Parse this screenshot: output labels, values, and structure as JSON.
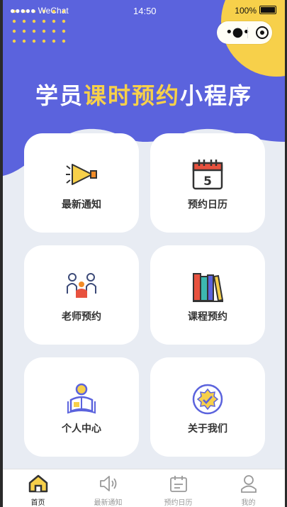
{
  "status_bar": {
    "carrier": "●●●●● WeChat",
    "time": "14:50",
    "battery": "100%"
  },
  "title": {
    "part1": "学员",
    "highlight": "课时预约",
    "part2": "小程序"
  },
  "colors": {
    "brand_purple": "#5b63dd",
    "accent_yellow": "#f7d04a",
    "background": "#e8ecf3"
  },
  "cards": [
    {
      "label": "最新通知",
      "icon": "megaphone-icon"
    },
    {
      "label": "预约日历",
      "icon": "calendar-icon"
    },
    {
      "label": "老师预约",
      "icon": "teacher-icon"
    },
    {
      "label": "课程预约",
      "icon": "books-icon"
    },
    {
      "label": "个人中心",
      "icon": "reading-person-icon"
    },
    {
      "label": "关于我们",
      "icon": "badge-icon"
    }
  ],
  "tabbar": [
    {
      "label": "首页",
      "icon": "home-icon",
      "active": true
    },
    {
      "label": "最新通知",
      "icon": "speaker-icon"
    },
    {
      "label": "预约日历",
      "icon": "calendar-icon"
    },
    {
      "label": "我的",
      "icon": "user-icon"
    }
  ],
  "calendar_day": "5"
}
